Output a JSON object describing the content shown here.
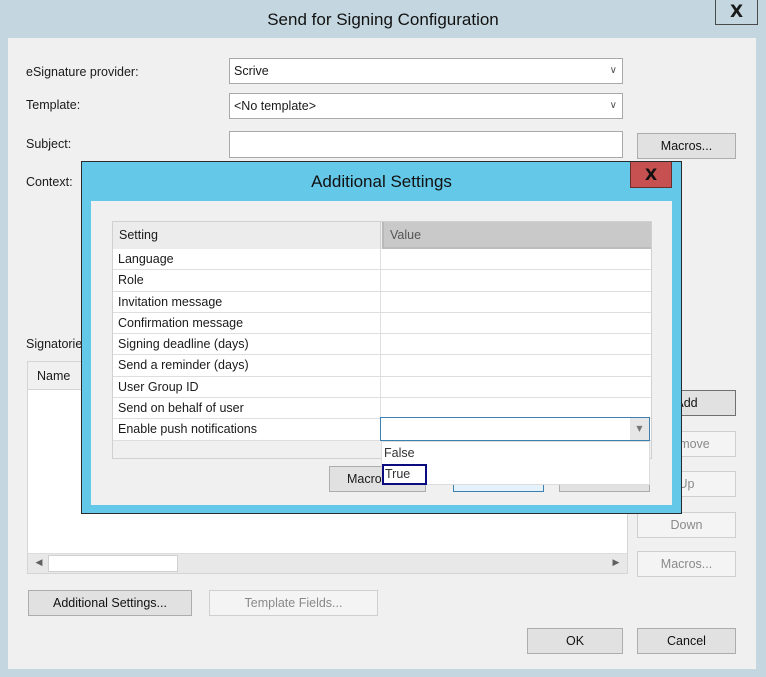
{
  "main_window": {
    "title": "Send for Signing Configuration",
    "close_label": "X",
    "fields": {
      "provider_label": "eSignature provider:",
      "provider_value": "Scrive",
      "template_label": "Template:",
      "template_value": "<No template>",
      "subject_label": "Subject:",
      "subject_value": "",
      "context_label": "Context:",
      "signatories_label": "Signatories:"
    },
    "buttons": {
      "subject_macros": "Macros...",
      "add": "Add",
      "remove": "Remove",
      "up": "Up",
      "down": "Down",
      "macros": "Macros...",
      "additional_settings": "Additional Settings...",
      "template_fields": "Template Fields...",
      "ok": "OK",
      "cancel": "Cancel"
    },
    "signatories_list": {
      "columns": [
        "Name"
      ],
      "rows": []
    },
    "dropdown_arrow": "chevron-down-icon"
  },
  "additional_settings": {
    "title": "Additional Settings",
    "close_label": "X",
    "columns": {
      "setting": "Setting",
      "value": "Value"
    },
    "rows": [
      {
        "setting": "Language",
        "value": ""
      },
      {
        "setting": "Role",
        "value": ""
      },
      {
        "setting": "Invitation message",
        "value": ""
      },
      {
        "setting": "Confirmation message",
        "value": ""
      },
      {
        "setting": "Signing deadline (days)",
        "value": ""
      },
      {
        "setting": "Send a reminder (days)",
        "value": ""
      },
      {
        "setting": "User Group ID",
        "value": ""
      },
      {
        "setting": "Send on behalf of user",
        "value": ""
      },
      {
        "setting": "Enable push notifications",
        "value": ""
      }
    ],
    "value_dropdown": {
      "current": "",
      "options": [
        "False",
        "True"
      ],
      "highlighted": "True"
    },
    "buttons": {
      "macros": "Macros...",
      "ok": "",
      "cancel": ""
    }
  }
}
